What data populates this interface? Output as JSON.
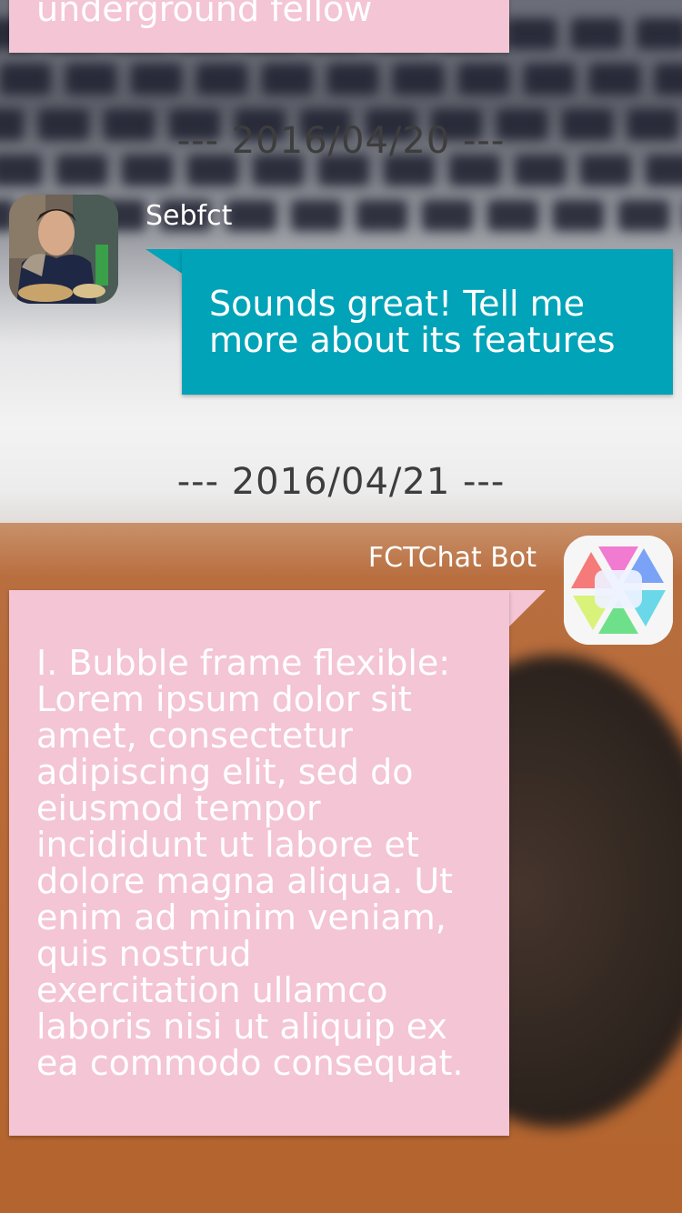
{
  "colors": {
    "user_bubble": "#00a3b8",
    "bot_bubble": "#f4c5d4",
    "text_on_bubble": "#ffffff",
    "date_separator": "#3d3d3d"
  },
  "messages": {
    "previous_partial_text": "underground fellow",
    "date_1": "--- 2016/04/20 ---",
    "user_name": "Sebfct",
    "user_text": "Sounds great! Tell me\nmore about its features",
    "date_2": "--- 2016/04/21 ---",
    "bot_name": "FCTChat Bot",
    "bot_text": "I. Bubble frame flexible:\nLorem ipsum dolor sit\namet, consectetur\nadipiscing elit, sed do\neiusmod tempor\nincididunt ut labore et\ndolore magna aliqua. Ut\nenim ad minim veniam,\nquis nostrud\nexercitation ullamco\nlaboris nisi ut aliquip ex\nea commodo consequat."
  },
  "icons": {
    "user_avatar": "user-photo-avatar",
    "bot_avatar": "fctchat-logo-avatar"
  }
}
